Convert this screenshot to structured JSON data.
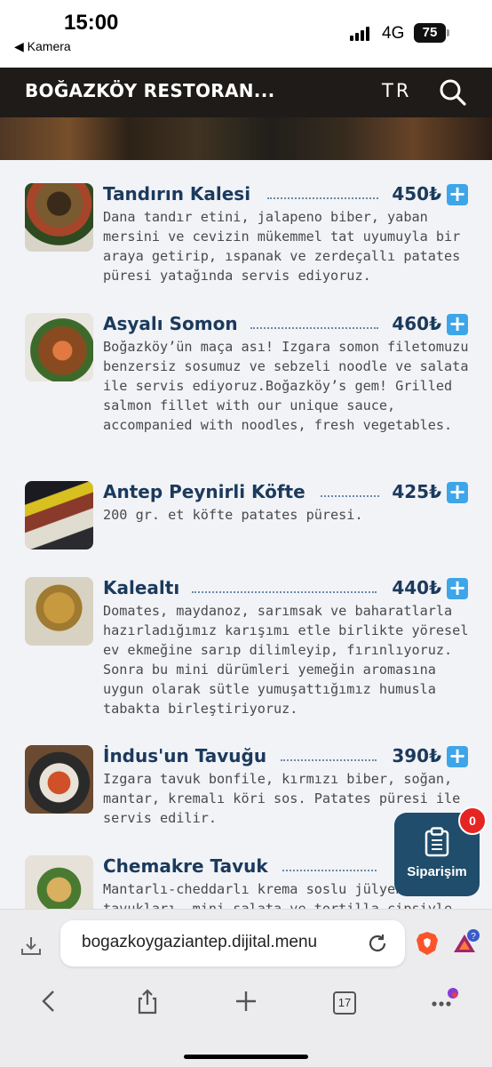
{
  "status_bar": {
    "time": "15:00",
    "back_label": "◀ Kamera",
    "network": "4G",
    "battery": "75"
  },
  "header": {
    "title": "BOĞAZKÖY RESTORAN...",
    "language": "TR",
    "icons": {
      "search": "search-icon"
    }
  },
  "menu": {
    "items": [
      {
        "name": "Tandırın Kalesi",
        "price": "450₺",
        "description": "Dana tandır etini, jalapeno biber, yaban mersini ve cevizin mükemmel tat uyumuyla bir araya getirip, ıspanak ve zerdeçallı patates püresi yatağında servis ediyoruz."
      },
      {
        "name": "Asyalı Somon",
        "price": "460₺",
        "description": "Boğazköy’ün maça ası! Izgara somon filetomuzu benzersiz sosumuz ve sebzeli noodle ve salata ile servis ediyoruz.Boğazköy’s gem! Grilled salmon fillet with our unique sauce, accompanied with noodles, fresh vegetables."
      },
      {
        "name": "Antep Peynirli Köfte",
        "price": "425₺",
        "description": "200 gr. et köfte patates püresi."
      },
      {
        "name": "Kalealtı",
        "price": "440₺",
        "description": "Domates, maydanoz, sarımsak ve baharatlarla hazırladığımız karışımı etle birlikte yöresel ev ekmeğine sarıp dilimleyip, fırınlıyoruz. Sonra bu mini dürümleri yemeğin aromasına uygun olarak sütle yumuşattığımız humusla tabakta birleştiriyoruz."
      },
      {
        "name": "İndus'un Tavuğu",
        "price": "390₺",
        "description": "Izgara tavuk bonfile, kırmızı biber, soğan, mantar, kremalı köri sos. Patates püresi ile servis edilir."
      },
      {
        "name": "Chemakre Tavuk",
        "price": "3",
        "description": "Mantarlı-cheddarlı krema soslu jülyen tavukları, mini salata ve tortilla cipsiyle servis"
      }
    ],
    "add_symbol": "+"
  },
  "order": {
    "label": "Siparişim",
    "count": "0"
  },
  "browser": {
    "url": "bogazkoygaziantep.dijital.menu",
    "tabs_count": "17",
    "rewards_badge": "?"
  },
  "colors": {
    "accent": "#3ea5e8",
    "title": "#1b3a5c",
    "order_button": "#1f4d6b",
    "badge": "#e52424",
    "header": "#1e1b18"
  }
}
